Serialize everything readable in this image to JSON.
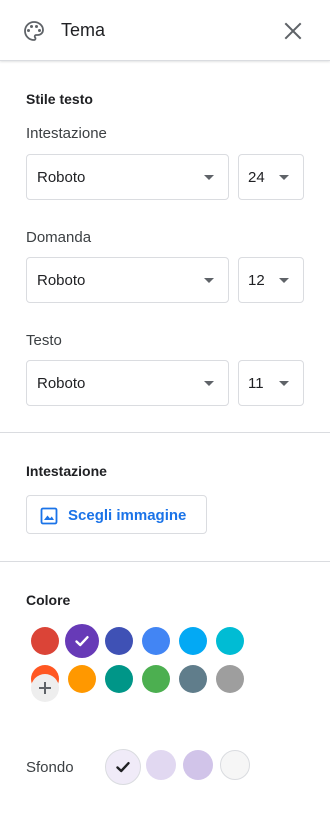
{
  "header": {
    "title": "Tema",
    "palette_icon": "palette-icon",
    "close_icon": "close-icon"
  },
  "text_style": {
    "title": "Stile testo",
    "heading": {
      "label": "Intestazione",
      "font": "Roboto",
      "size": "24"
    },
    "question": {
      "label": "Domanda",
      "font": "Roboto",
      "size": "12"
    },
    "text": {
      "label": "Testo",
      "font": "Roboto",
      "size": "11"
    }
  },
  "header_section": {
    "title": "Intestazione",
    "choose_image_label": "Scegli immagine"
  },
  "color_section": {
    "title": "Colore",
    "theme_colors": [
      "#db4437",
      "#673ab7",
      "#3f51b5",
      "#4285f4",
      "#03a9f4",
      "#00bcd4",
      "#ff5722",
      "#ff9800",
      "#009688",
      "#4caf50",
      "#607d8b",
      "#9e9e9e"
    ],
    "selected_theme_color": "#673ab7",
    "background_label": "Sfondo",
    "background_colors": [
      "#f0ebf8",
      "#e1d8f1",
      "#d1c4e9",
      "#f6f6f6"
    ],
    "selected_background_color": "#f0ebf8"
  }
}
